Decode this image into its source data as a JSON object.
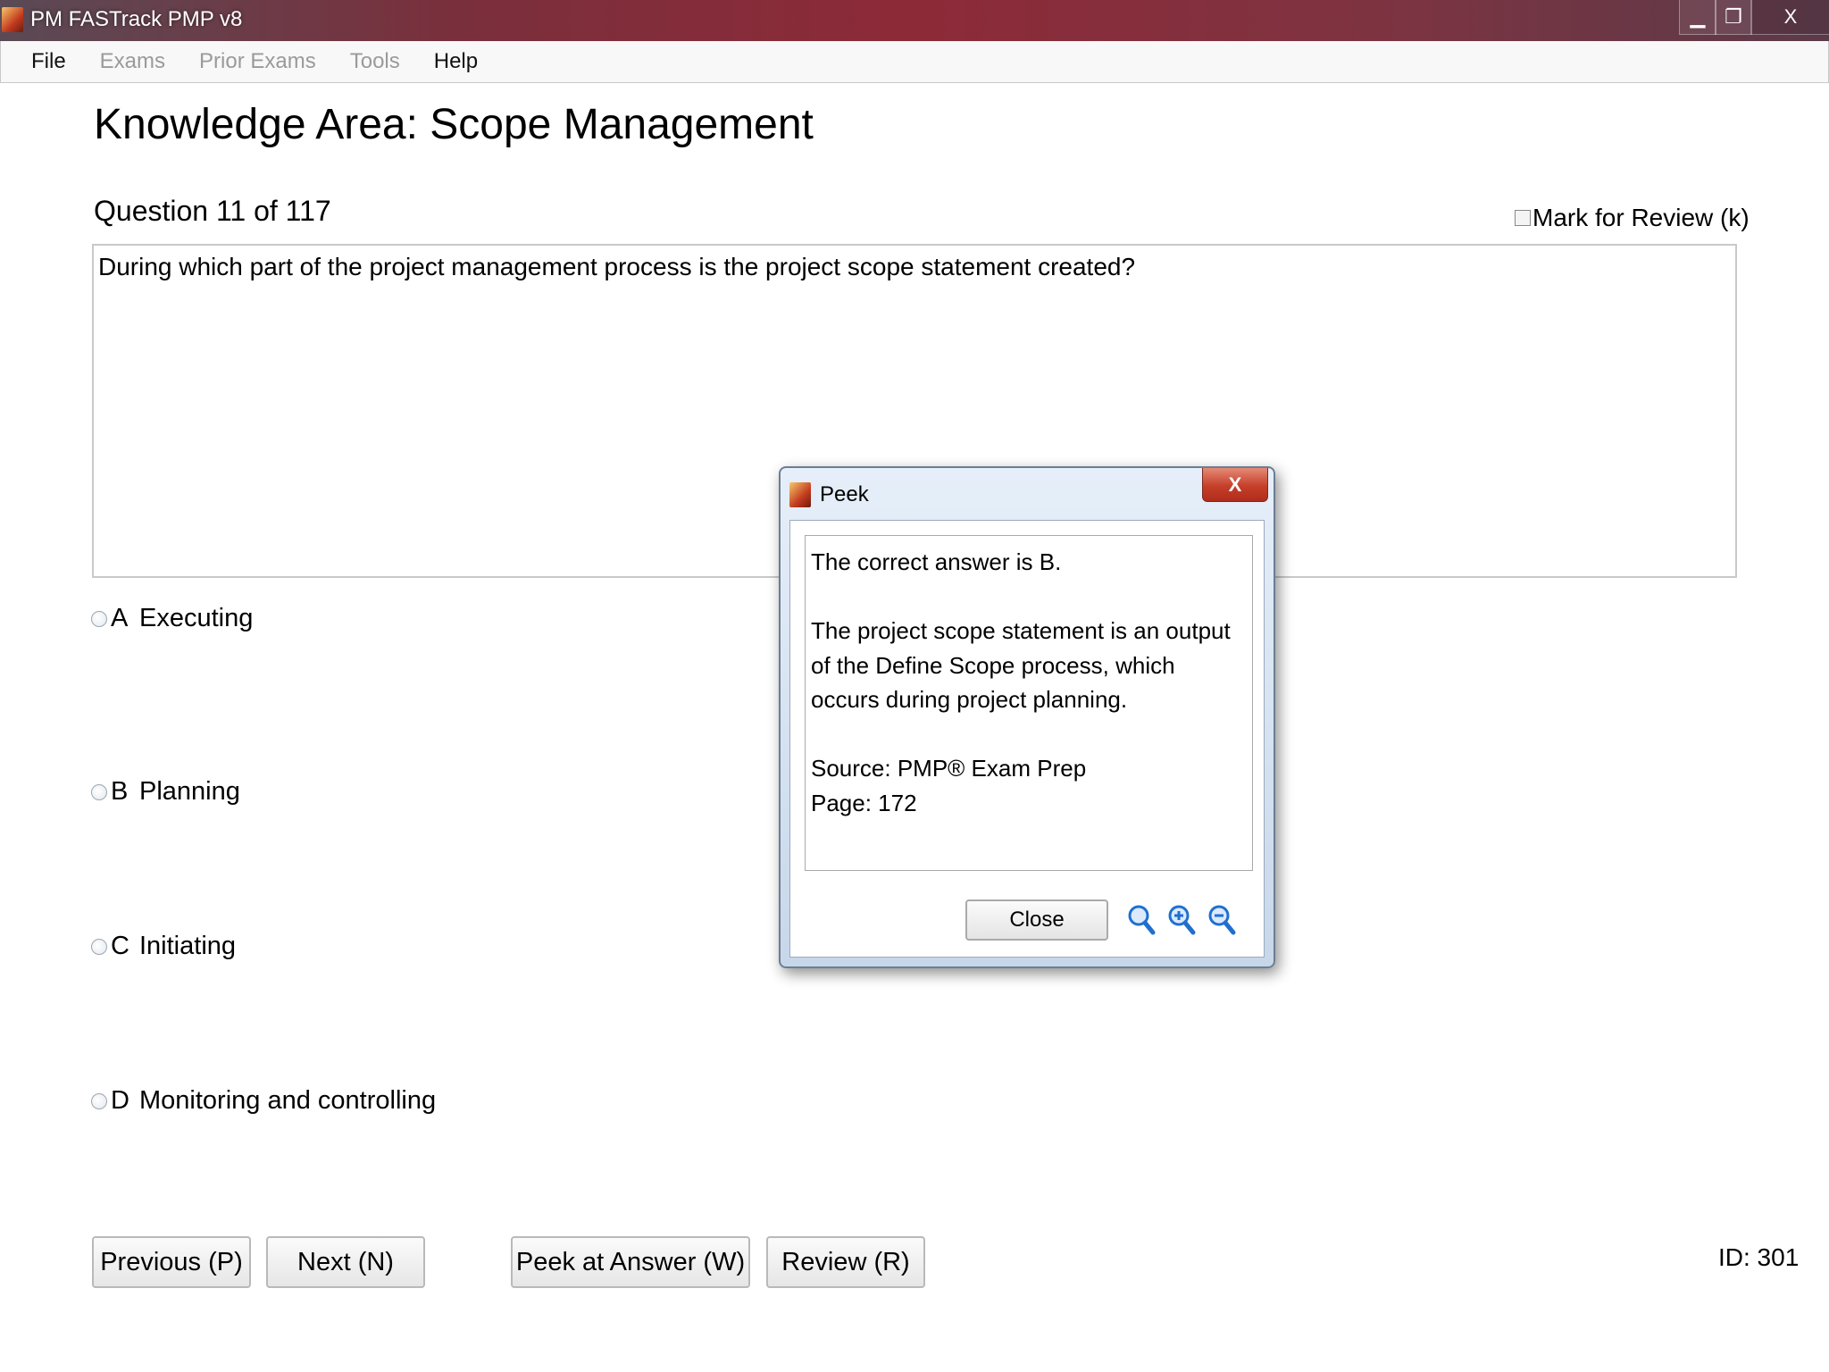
{
  "window": {
    "title": "PM FASTrack PMP v8",
    "minimize_glyph": "▁",
    "maximize_glyph": "❐",
    "close_glyph": "X"
  },
  "menu": [
    {
      "label": "File",
      "enabled": true
    },
    {
      "label": "Exams",
      "enabled": false
    },
    {
      "label": "Prior Exams",
      "enabled": false
    },
    {
      "label": "Tools",
      "enabled": false
    },
    {
      "label": "Help",
      "enabled": true
    }
  ],
  "page": {
    "knowledge_area": "Knowledge Area: Scope Management",
    "question_number": "Question 11 of 117",
    "mark_for_review": "Mark for Review (k)",
    "question_text": "During which part of the project management process is the project scope statement created?",
    "id_label": "ID: 301"
  },
  "answers": [
    {
      "letter": "A",
      "text": "Executing"
    },
    {
      "letter": "B",
      "text": "Planning"
    },
    {
      "letter": "C",
      "text": "Initiating"
    },
    {
      "letter": "D",
      "text": "Monitoring and controlling"
    }
  ],
  "buttons": {
    "previous": "Previous (P)",
    "next": "Next (N)",
    "peek": "Peek at Answer (W)",
    "review": "Review (R)"
  },
  "peek_dialog": {
    "title": "Peek",
    "close_glyph": "X",
    "line1": "The correct answer is B.",
    "line2": "The project scope statement is an output of the Define Scope process, which occurs during project planning.",
    "source": "Source: PMP® Exam Prep",
    "page": "Page: 172",
    "close_button": "Close",
    "icons": [
      "magnifier-icon",
      "zoom-in-icon",
      "zoom-out-icon"
    ],
    "accent_color": "#1f6fd1"
  }
}
